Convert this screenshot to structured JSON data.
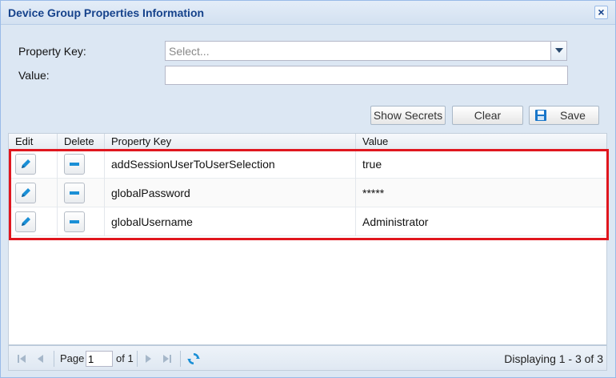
{
  "dialog": {
    "title": "Device Group Properties Information",
    "close_label": "×"
  },
  "form": {
    "property_key_label": "Property Key:",
    "property_key_placeholder": "Select...",
    "value_label": "Value:",
    "value": ""
  },
  "toolbar": {
    "show_secrets_label": "Show Secrets",
    "clear_label": "Clear",
    "save_label": "Save"
  },
  "grid": {
    "columns": [
      "Edit",
      "Delete",
      "Property Key",
      "Value"
    ],
    "rows": [
      {
        "key": "addSessionUserToUserSelection",
        "value": "true"
      },
      {
        "key": "globalPassword",
        "value": "*****"
      },
      {
        "key": "globalUsername",
        "value": "Administrator"
      }
    ]
  },
  "pager": {
    "page_label": "Page",
    "page_value": "1",
    "of_label": "of 1",
    "display_msg": "Displaying 1 - 3 of 3"
  },
  "colors": {
    "title_text": "#15428b",
    "highlight": "#e0161e",
    "icon_blue": "#1a8fd6"
  },
  "icons": {
    "close": "close-icon",
    "combo_trigger": "chevron-down-icon",
    "save": "save-icon",
    "edit": "pencil-icon",
    "delete": "minus-icon",
    "first": "first-page-icon",
    "prev": "prev-page-icon",
    "next": "next-page-icon",
    "last": "last-page-icon",
    "refresh": "refresh-icon"
  }
}
